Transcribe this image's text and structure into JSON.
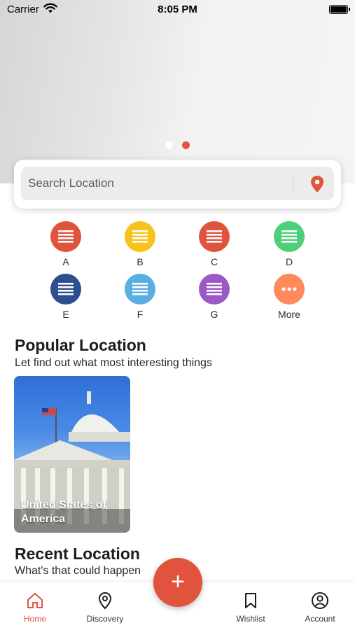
{
  "status_bar": {
    "carrier": "Carrier",
    "time": "8:05 PM"
  },
  "banner": {
    "pages": 2,
    "active_page": 2
  },
  "search": {
    "placeholder": "Search Location"
  },
  "categories": [
    {
      "label": "A",
      "color": "#e0533c"
    },
    {
      "label": "B",
      "color": "#f6c31d"
    },
    {
      "label": "C",
      "color": "#e0533c"
    },
    {
      "label": "D",
      "color": "#4fcf7a"
    },
    {
      "label": "E",
      "color": "#2e4f8f"
    },
    {
      "label": "F",
      "color": "#5aaee3"
    },
    {
      "label": "G",
      "color": "#9b59c6"
    },
    {
      "label": "More",
      "color": "#ff8a5c"
    }
  ],
  "popular": {
    "title": "Popular Location",
    "subtitle": "Let find out what most interesting things",
    "places": [
      {
        "name": "United States of America"
      }
    ]
  },
  "recent": {
    "title": "Recent Location",
    "subtitle": "What's that could happen"
  },
  "fab": {
    "label": "+"
  },
  "bottom_nav": [
    {
      "label": "Home",
      "icon": "home-icon",
      "active": true
    },
    {
      "label": "Discovery",
      "icon": "location-pin-icon",
      "active": false
    },
    {
      "label": "Wishlist",
      "icon": "bookmark-icon",
      "active": false
    },
    {
      "label": "Account",
      "icon": "account-icon",
      "active": false
    }
  ],
  "colors": {
    "accent": "#e0533c"
  }
}
